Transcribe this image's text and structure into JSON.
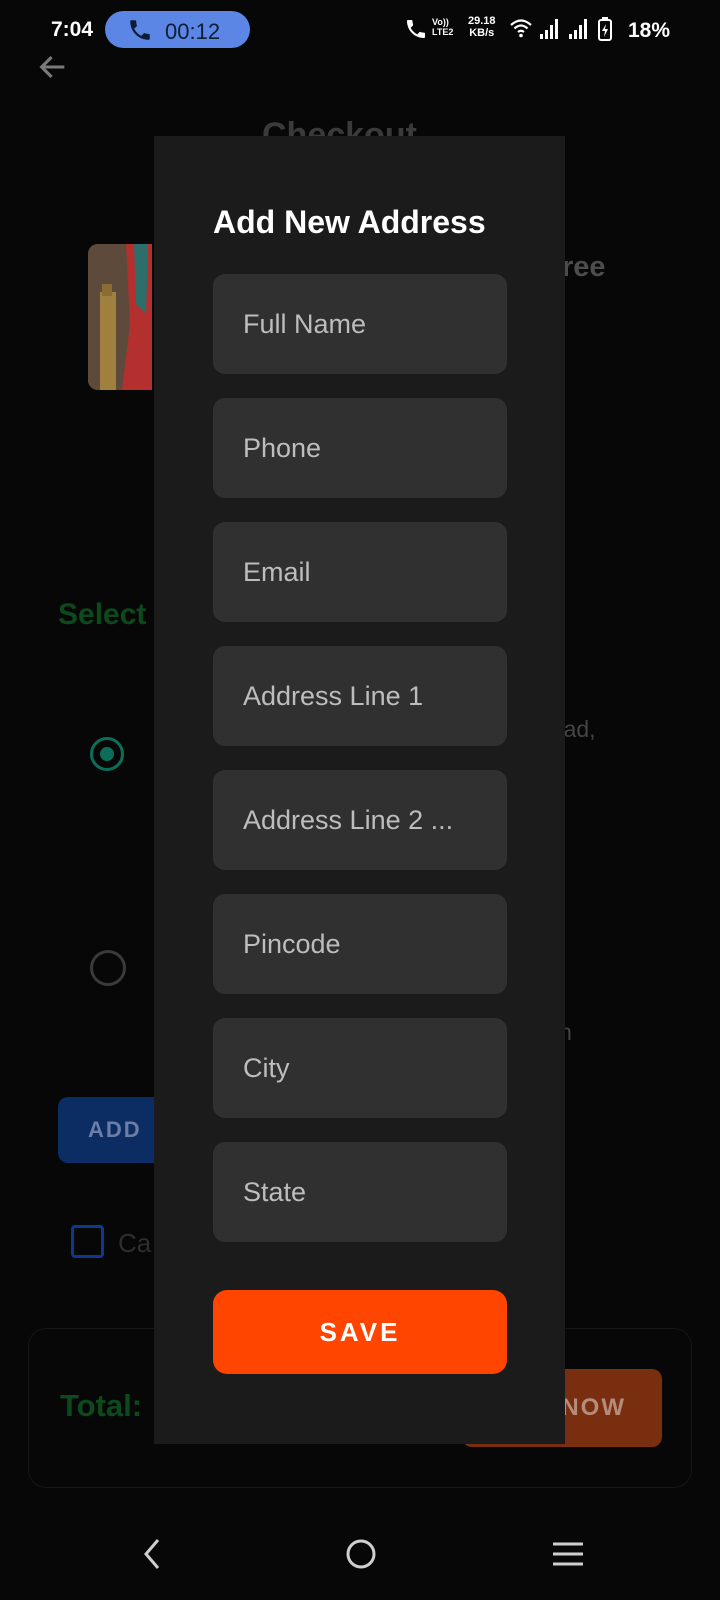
{
  "status_bar": {
    "time": "7:04",
    "call_duration": "00:12",
    "volte_top": "Vo))",
    "volte_bottom": "LTE2",
    "data_rate_value": "29.18",
    "data_rate_unit": "KB/s",
    "battery": "18%"
  },
  "background": {
    "title": "Checkout",
    "product_name_tail": "ree",
    "select_heading": "Select",
    "address1_tail": "abad,",
    "address2_tail": "om",
    "add_button_label": "ADD",
    "checkbox_label_tail": "Ca",
    "total_label": "Total:",
    "buy_button_label": "NOW"
  },
  "modal": {
    "title": "Add New Address",
    "fields": [
      {
        "placeholder": "Full Name"
      },
      {
        "placeholder": "Phone"
      },
      {
        "placeholder": "Email"
      },
      {
        "placeholder": "Address Line 1"
      },
      {
        "placeholder": "Address Line 2 ..."
      },
      {
        "placeholder": "Pincode"
      },
      {
        "placeholder": "City"
      },
      {
        "placeholder": "State"
      }
    ],
    "save_label": "SAVE"
  },
  "colors": {
    "accent_save": "#ff4500",
    "call_pill": "#5b86e5",
    "success_green": "#0c4a1e"
  },
  "icons": [
    "back-arrow-icon",
    "phone-icon",
    "wifi-icon",
    "signal-icon",
    "battery-icon",
    "nav-back-icon",
    "nav-home-icon",
    "nav-menu-icon"
  ]
}
